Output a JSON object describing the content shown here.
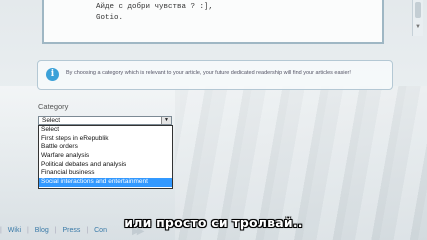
{
  "editor": {
    "line1": "Айде с добри чувства ? :],",
    "line2": "Gotio."
  },
  "info": {
    "icon": "info-icon",
    "glyph": "i",
    "text": "By choosing a category which is relevant to your article, your future dedicated readership will find your articles easier!"
  },
  "category": {
    "label": "Category",
    "selected": "Select",
    "options": [
      "Select",
      "First steps in eRepublik",
      "Battle orders",
      "Warfare analysis",
      "Political debates and analysis",
      "Financial business",
      "Social interactions and entertainment"
    ],
    "highlighted_index": 6
  },
  "footer": {
    "links": [
      "Wiki",
      "Blog",
      "Press",
      "Con"
    ]
  },
  "subtitle": "или просто си тролвай..",
  "colors": {
    "highlight": "#3399ff",
    "info_icon": "#3ba1d8",
    "link": "#3a7aa8"
  }
}
